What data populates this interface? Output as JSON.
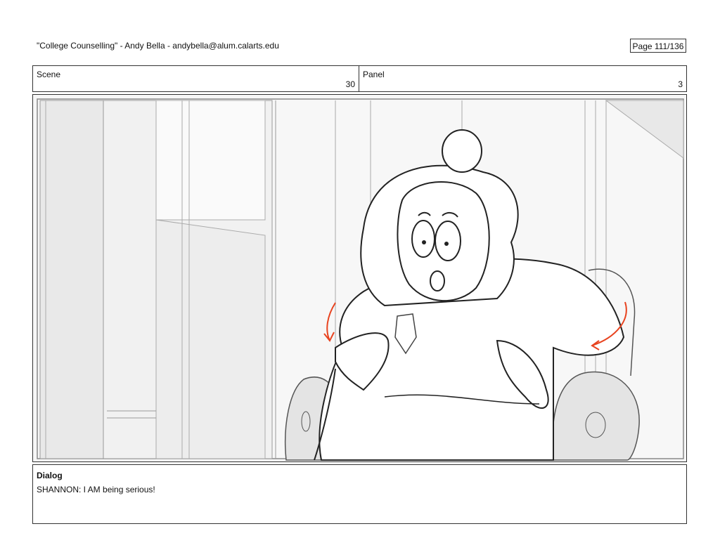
{
  "header": {
    "title": "\"College Counselling\"  -  Andy Bella  -   andybella@alum.calarts.edu",
    "page": "Page 111/136"
  },
  "scene": {
    "label": "Scene",
    "value": "30"
  },
  "panel": {
    "label": "Panel",
    "value": "3"
  },
  "dialog": {
    "label": "Dialog",
    "text": "SHANNON: I AM being serious!"
  },
  "sketch": {
    "description_icon": "storyboard-sketch-shannon-in-armchair",
    "accent_color": "#e8431f"
  }
}
